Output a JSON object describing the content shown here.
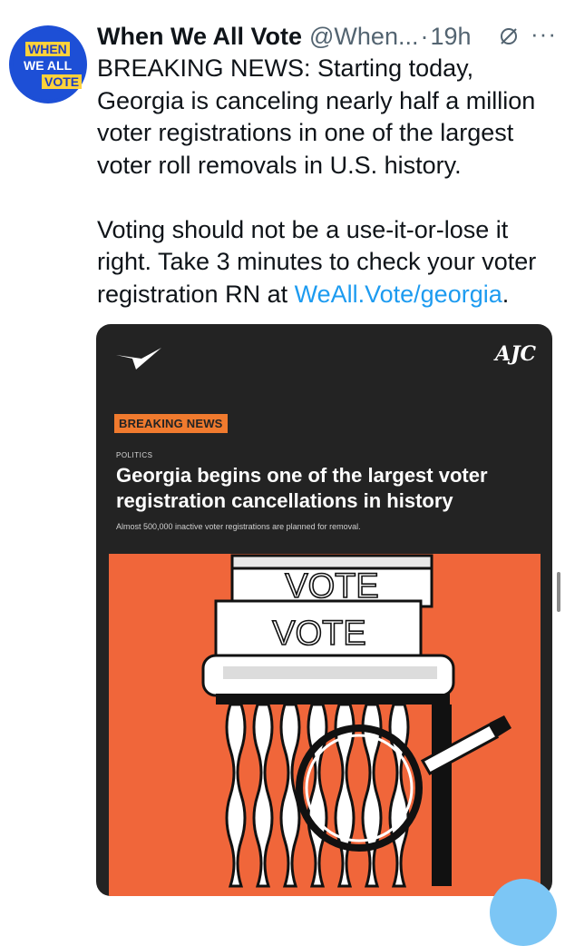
{
  "author": {
    "avatar_lines": [
      "WHEN",
      "WE ALL",
      "VOTE"
    ],
    "name": "When We All Vote",
    "handle": "@When...",
    "separator": "·",
    "time": "19h"
  },
  "tweet": {
    "paragraph1": "BREAKING NEWS: Starting today, Georgia is canceling nearly half a million voter registrations in one of the largest voter roll removals in U.S. history.",
    "paragraph2_text": "Voting should not be a use-it-or-lose it right. Take 3 minutes to check your voter registration RN at ",
    "paragraph2_link": "WeAll.Vote/georgia",
    "paragraph2_end": "."
  },
  "card": {
    "brand": "AJC",
    "badge": "BREAKING NEWS",
    "section": "POLITICS",
    "headline": "Georgia begins one of the largest voter registration cancellations in history",
    "subline": "Almost 500,000 inactive voter registrations are planned for removal.",
    "ballot_words": [
      "VOTE",
      "VOTE"
    ]
  },
  "icons": {
    "grok": "grok-icon",
    "more": "more-icon",
    "publisher_logo": "checkmark-logo-icon",
    "compose": "compose-fab-icon"
  },
  "colors": {
    "link": "#1d9bf0",
    "card_bg": "#232323",
    "illustration_bg": "#f0663a",
    "badge": "#f07a2e",
    "avatar_bg": "#1d4fd6",
    "avatar_accent": "#ffd23a"
  }
}
